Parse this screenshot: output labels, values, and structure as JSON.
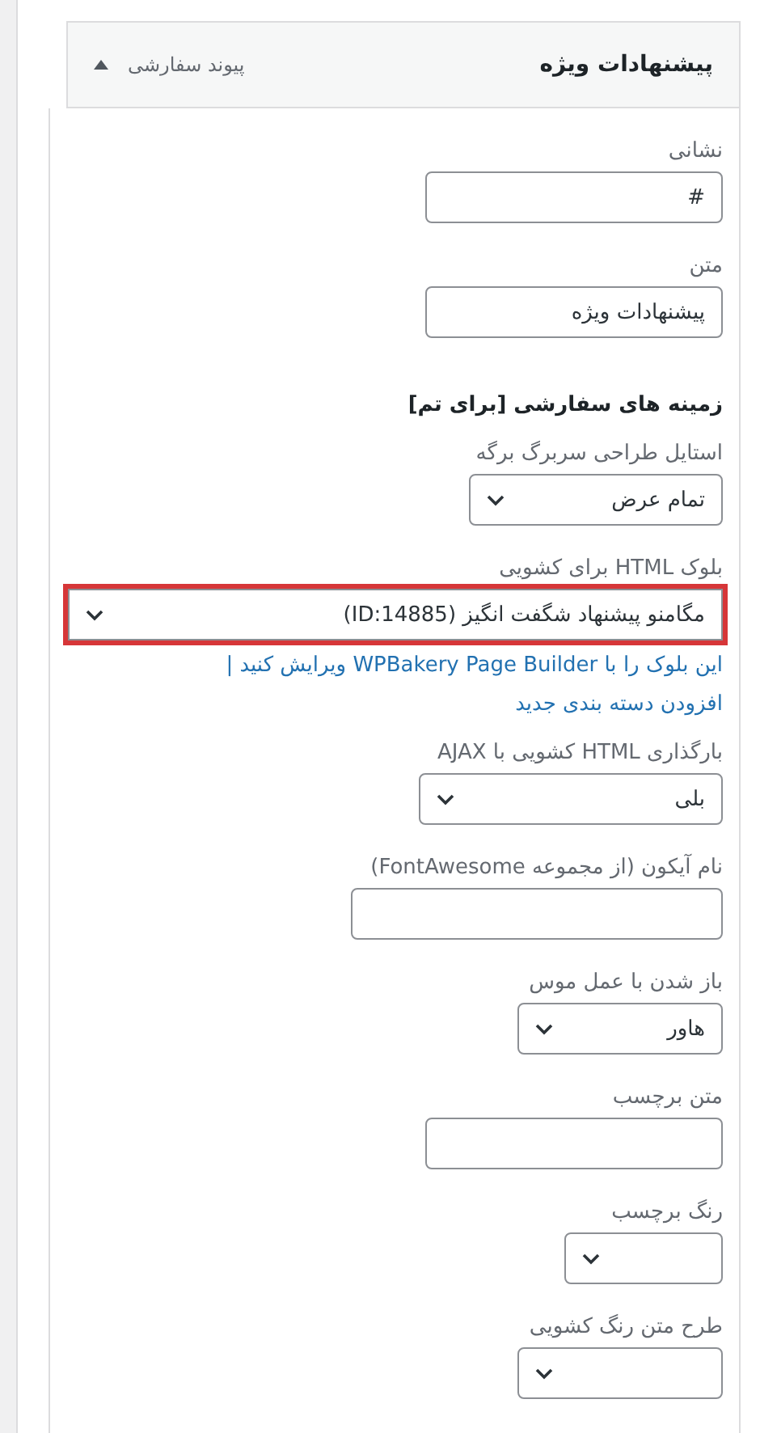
{
  "panel": {
    "title": "پیشنهادات ویژه",
    "type_label": "پیوند سفارشی",
    "expanded": true
  },
  "items": [
    {
      "kind": "text",
      "label": "نشانی",
      "value": "#",
      "highlighted": false
    },
    {
      "kind": "text",
      "label": "متن",
      "value": "پیشنهادات ویژه",
      "highlighted": false
    },
    {
      "kind": "heading",
      "label": "زمینه های سفارشی [برای تم]"
    },
    {
      "kind": "select",
      "label": "استایل طراحی سربرگ برگه",
      "value": "تمام عرض",
      "highlighted": false
    },
    {
      "kind": "select",
      "label": "بلوک HTML برای کشویی",
      "value": "مگامنو پیشنهاد شگفت انگیز (ID:14885)",
      "highlighted": true,
      "links": [
        "این بلوک را با WPBakery Page Builder ویرایش کنید",
        "|",
        "افزودن دسته بندی جدید"
      ]
    },
    {
      "kind": "select",
      "label": "بارگذاری HTML کشویی با AJAX",
      "value": "بلی",
      "highlighted": false
    },
    {
      "kind": "text",
      "label": "نام آیکون (از مجموعه FontAwesome)",
      "highlighted": false
    },
    {
      "kind": "select",
      "label": "باز شدن با عمل موس",
      "value": "هاور",
      "highlighted": false
    },
    {
      "kind": "text",
      "label": "متن برچسب",
      "highlighted": false
    },
    {
      "kind": "select",
      "label": "رنگ برچسب",
      "highlighted": false
    },
    {
      "kind": "select",
      "label": "طرح متن رنگ کشویی",
      "highlighted": false
    }
  ]
}
